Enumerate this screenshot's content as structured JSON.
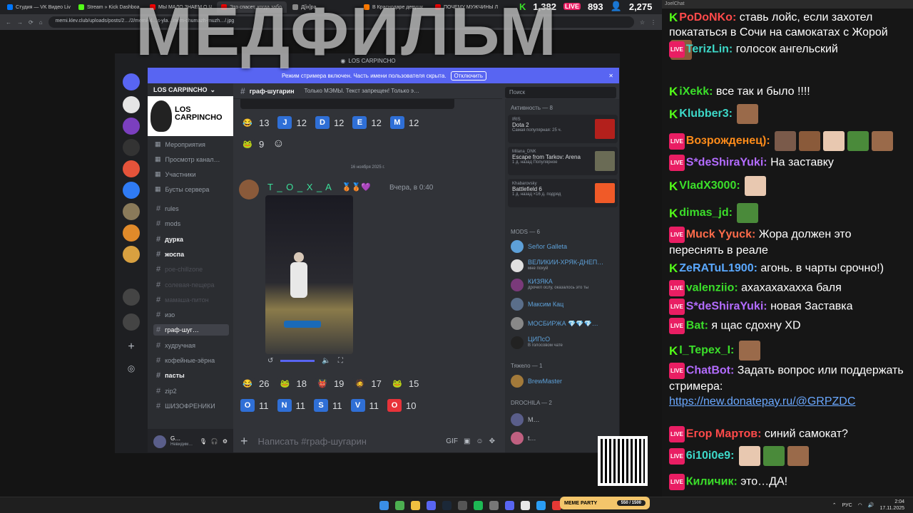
{
  "browser": {
    "tabs": [
      {
        "label": "Студия — VK Видео Liv",
        "color": "#0077ff"
      },
      {
        "label": "Stream » Kick Dashboa",
        "color": "#53fc18"
      },
      {
        "label": "МЫ МАЛО ЗНАЕМ О Ч",
        "color": "#ff0000"
      },
      {
        "label": "Это спасет, когда забо",
        "color": "#ff0000"
      },
      {
        "label": "Д[іх]ра",
        "color": "#888888"
      },
      {
        "label": "В Краснодаре девушк",
        "color": "#ff7a00"
      },
      {
        "label": "ПОЧЕМУ МУЖЧИНЫ Л",
        "color": "#ff0000"
      }
    ],
    "url": "memi.klev.club/uploads/posts/2…/2/memi-kl…s-yla…mem-chumazh-muzh…/.jpg"
  },
  "stats": {
    "kick": "1,382",
    "live": "893",
    "users": "2,275"
  },
  "overlay_title": "МЕДФИЛЬМ",
  "discord": {
    "window_title": "LOS CARPINCHO",
    "streamer_bar_text": "Режим стримера включен. Часть имени пользователя скрыта.",
    "streamer_bar_button": "Отключить",
    "server_name": "LOS CARPINCHO",
    "banner_text": "LOS CARPINCHO",
    "nav": [
      "Мероприятия",
      "Просмотр канал…",
      "Участники",
      "Бусты сервера"
    ],
    "channels": [
      {
        "name": "rules",
        "style": ""
      },
      {
        "name": "mods",
        "style": ""
      },
      {
        "name": "дурка",
        "style": "bold"
      },
      {
        "name": "жоспа",
        "style": "bold"
      },
      {
        "name": "poe-chillzone",
        "style": "muted"
      },
      {
        "name": "солевая-пещера",
        "style": "muted"
      },
      {
        "name": "мамаша-питон",
        "style": "muted"
      },
      {
        "name": "изо",
        "style": ""
      },
      {
        "name": "граф-шуг…",
        "style": "sel"
      },
      {
        "name": "худручная",
        "style": ""
      },
      {
        "name": "кофейные-зёрна",
        "style": ""
      },
      {
        "name": "пасты",
        "style": "bold"
      },
      {
        "name": "zip2",
        "style": ""
      },
      {
        "name": "ШИЗОФРЕНИКИ",
        "style": ""
      }
    ],
    "user": {
      "name": "G…",
      "status": "Невидим…"
    },
    "channel_name": "граф-шугарин",
    "channel_topic": "Только МЭМЫ. Текст запрещен! Только э…",
    "search_placeholder": "Поиск",
    "reactions_top": [
      {
        "emoji": "😂",
        "count": "13",
        "color": "#313338"
      },
      {
        "emoji": "J",
        "count": "12",
        "color": "#2f6fd6"
      },
      {
        "emoji": "D",
        "count": "12",
        "color": "#2f6fd6"
      },
      {
        "emoji": "E",
        "count": "12",
        "color": "#2f6fd6"
      },
      {
        "emoji": "M",
        "count": "12",
        "color": "#2f6fd6"
      }
    ],
    "reactions_top2": [
      {
        "emoji": "🐸",
        "count": "9",
        "color": "#313338"
      }
    ],
    "date_divider": "16 ноября 2025 г.",
    "message": {
      "author": "T _ O _ X _ A",
      "time": "Вчера, в 0:40"
    },
    "reactions_bottom": [
      {
        "emoji": "😂",
        "count": "26",
        "color": "#313338"
      },
      {
        "emoji": "🐸",
        "count": "18",
        "color": "#313338"
      },
      {
        "emoji": "👹",
        "count": "19",
        "color": "#313338"
      },
      {
        "emoji": "🧔",
        "count": "17",
        "color": "#313338"
      },
      {
        "emoji": "🐸",
        "count": "15",
        "color": "#313338"
      }
    ],
    "reactions_bottom2": [
      {
        "emoji": "O",
        "count": "11",
        "color": "#2f6fd6"
      },
      {
        "emoji": "N",
        "count": "11",
        "color": "#2f6fd6"
      },
      {
        "emoji": "S",
        "count": "11",
        "color": "#2f6fd6"
      },
      {
        "emoji": "V",
        "count": "11",
        "color": "#2f6fd6"
      },
      {
        "emoji": "O",
        "count": "10",
        "color": "#e8333a"
      }
    ],
    "composer_placeholder": "Написать #граф-шугарин",
    "activity_header": "Активность — 8",
    "activities": [
      {
        "user": "IRIS",
        "game": "Dota 2",
        "sub": "Самая популярная: 25 ч.",
        "color": "#b3201c"
      },
      {
        "user": "Milana_DNK",
        "game": "Escape from Tarkov: Arena",
        "sub": "1 д. назад  Популярное",
        "color": "#6a6b55"
      },
      {
        "user": "Khabarovsky",
        "game": "Battlefield 6",
        "sub": "1 д. назад  ×16 д. подряд",
        "color": "#f05a28"
      }
    ],
    "mods_header": "MODS — 6",
    "mods": [
      {
        "name": "Señor Galleta",
        "status": "",
        "color": "#5da0d8",
        "nc": "#5da0d8"
      },
      {
        "name": "ВЕЛИКИЙ-ХРЯК-ДНЕП…",
        "status": "мне похуй",
        "color": "#e0e0e0",
        "nc": "#5da0d8"
      },
      {
        "name": "КИЗЯКА",
        "status": "дрочил ослу, оказалось это ты",
        "color": "#7a3a7a",
        "nc": "#5da0d8"
      },
      {
        "name": "Максим Кац",
        "status": "",
        "color": "#5a6e8a",
        "nc": "#5da0d8"
      },
      {
        "name": "МОСБИРЖА 💎💎💎…",
        "status": "",
        "color": "#888",
        "nc": "#5da0d8"
      },
      {
        "name": "ЦИПсО",
        "status": "В голосовом чате",
        "color": "#222",
        "nc": "#5da0d8"
      }
    ],
    "heavy_header": "Тяжело — 1",
    "heavy": [
      {
        "name": "BrewMaster",
        "color": "#a37a3a",
        "nc": "#5da0d8"
      }
    ],
    "drochila_header": "DROCHILA — 2",
    "drochila": [
      {
        "name": "M…",
        "color": "#5a5e8a",
        "nc": "#b5bac1"
      },
      {
        "name": "t…",
        "color": "#c06080",
        "nc": "#b5bac1"
      }
    ]
  },
  "chat": {
    "app_title": "JoelChat",
    "messages": [
      {
        "src": "kick",
        "user": "PoDoNKo:",
        "ucolor": "#ff4a4a",
        "text": "ставь лойс, если захотел покататься в Сочи на самокатах с Жорой",
        "emotes": 1,
        "link": ""
      },
      {
        "src": "live",
        "user": "TerizLin:",
        "ucolor": "#3dd8c8",
        "text": "голосок ангельский",
        "emotes": 0,
        "link": ""
      },
      {
        "src": "kick",
        "user": "iXekk:",
        "ucolor": "#3bdf2a",
        "text": "все так и было !!!!",
        "emotes": 0,
        "link": ""
      },
      {
        "src": "kick",
        "user": "Klubber3:",
        "ucolor": "#3dd8c8",
        "text": "",
        "emotes": 1,
        "link": ""
      },
      {
        "src": "live",
        "user": "Возрожденец):",
        "ucolor": "#ff8c1a",
        "text": "",
        "emotes": 5,
        "link": ""
      },
      {
        "src": "live",
        "user": "S*deShiraYuki:",
        "ucolor": "#b36cff",
        "text": "На заставку",
        "emotes": 0,
        "link": ""
      },
      {
        "src": "kick",
        "user": "VladX3000:",
        "ucolor": "#3bdf2a",
        "text": "",
        "emotes": 1,
        "link": ""
      },
      {
        "src": "kick",
        "user": "dimas_jd:",
        "ucolor": "#3bdf2a",
        "text": "",
        "emotes": 1,
        "link": ""
      },
      {
        "src": "live",
        "user": "Muck Yyuck:",
        "ucolor": "#ff6b4a",
        "text": "Жора должен это переснять в реале",
        "emotes": 0,
        "link": ""
      },
      {
        "src": "kick",
        "user": "ZeRATuL1900:",
        "ucolor": "#5aa8ff",
        "text": "агонь. в чарты срочно!)",
        "emotes": 0,
        "link": ""
      },
      {
        "src": "live",
        "user": "valenziio:",
        "ucolor": "#3bdf2a",
        "text": "ахахахахахха баля",
        "emotes": 0,
        "link": ""
      },
      {
        "src": "live",
        "user": "S*deShiraYuki:",
        "ucolor": "#b36cff",
        "text": "новая Заставка",
        "emotes": 0,
        "link": ""
      },
      {
        "src": "live",
        "user": "Bat:",
        "ucolor": "#3bdf2a",
        "text": "я щас сдохну XD",
        "emotes": 0,
        "link": ""
      },
      {
        "src": "kick",
        "user": "I_Tepex_I:",
        "ucolor": "#3bdf2a",
        "text": "",
        "emotes": 1,
        "link": ""
      },
      {
        "src": "live",
        "user": "ChatBot:",
        "ucolor": "#b36cff",
        "text": "Задать вопрос или поддержать стримера:",
        "emotes": 0,
        "link": "https://new.donatepay.ru/@GRPZDC"
      },
      {
        "src": "live",
        "user": "Егор Мартов:",
        "ucolor": "#ff4a4a",
        "text": "синий самокат?",
        "emotes": 0,
        "link": ""
      },
      {
        "src": "live",
        "user": "6i10i0e9:",
        "ucolor": "#3dd8c8",
        "text": "",
        "emotes": 3,
        "link": ""
      },
      {
        "src": "live",
        "user": "Киличик:",
        "ucolor": "#3bdf2a",
        "text": "это…ДА!",
        "emotes": 0,
        "link": ""
      }
    ]
  },
  "taskbar": {
    "lang": "РУС",
    "time": "2:04",
    "date": "17.11.2025"
  },
  "meme_party": {
    "label": "MEME PARTY",
    "progress": "550 / 1500"
  }
}
